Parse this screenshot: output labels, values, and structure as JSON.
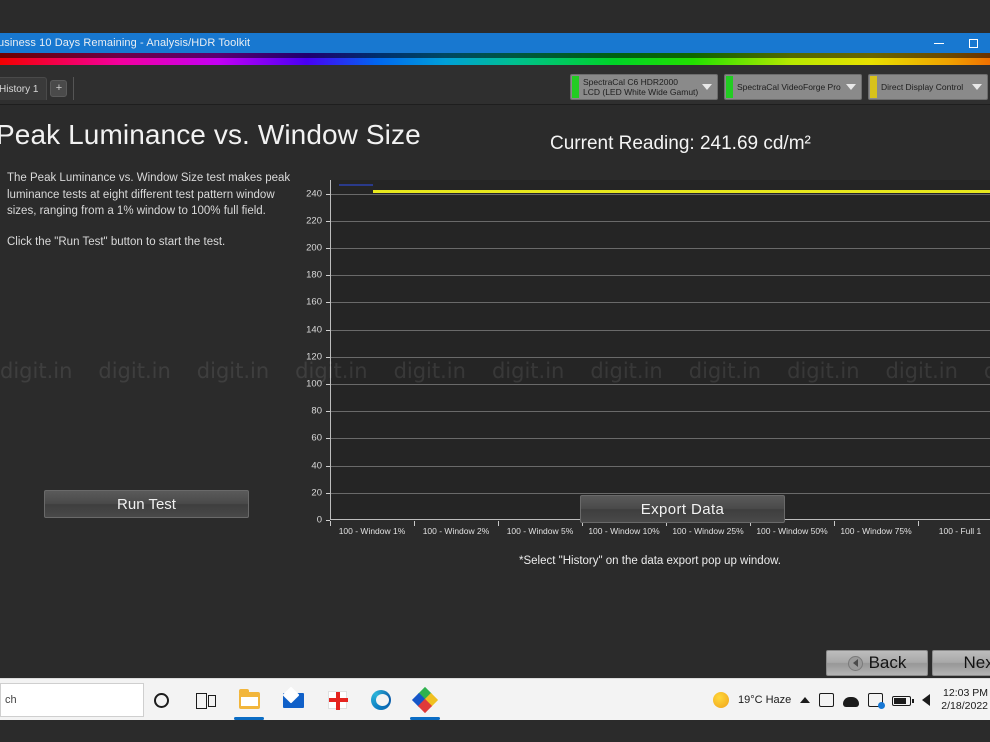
{
  "window": {
    "title": "usiness 10 Days Remaining  - Analysis/HDR Toolkit",
    "minimize_label": "Minimize",
    "maximize_label": "Maximize",
    "accent_color": "#1878d0"
  },
  "toolbar": {
    "tab_label": "History 1",
    "add_tab_label": "+",
    "devices": [
      {
        "line1": "SpectraCal C6 HDR2000",
        "line2": "LCD (LED White Wide Gamut)",
        "status_color": "#22cc22"
      },
      {
        "line1": "SpectraCal VideoForge Pro",
        "line2": "",
        "status_color": "#22cc22"
      },
      {
        "line1": "Direct Display Control",
        "line2": "",
        "status_color": "#d8c21a"
      }
    ]
  },
  "main": {
    "page_title": "Peak Luminance vs. Window Size",
    "description_p1": "The Peak Luminance vs. Window Size test makes peak luminance tests at eight different test pattern window sizes, ranging from a 1% window to 100% full field.",
    "description_p2": "Click the \"Run Test\" button to start the test.",
    "run_test_label": "Run Test",
    "current_reading": "Current Reading: 241.69 cd/m²",
    "export_label": "Export  Data",
    "export_note": "*Select \"History\" on the data export pop up window.",
    "back_label": "Back",
    "next_label": "Next"
  },
  "chart_data": {
    "type": "line",
    "title": "",
    "xlabel": "",
    "ylabel": "",
    "ylim": [
      0,
      250
    ],
    "yticks": [
      0,
      20,
      40,
      60,
      80,
      100,
      120,
      140,
      160,
      180,
      200,
      220,
      240
    ],
    "grid": true,
    "legend": "none",
    "categories": [
      "100 - Window 1%",
      "100 - Window 2%",
      "100 - Window 5%",
      "100 - Window 10%",
      "100 - Window 25%",
      "100 - Window 50%",
      "100 - Window 75%",
      "100 - Full 1"
    ],
    "series": [
      {
        "name": "Peak Luminance",
        "color": "#e8e81e",
        "values": [
          241.69,
          241.69,
          241.69,
          241.69,
          241.69,
          241.69,
          241.69,
          241.69
        ]
      }
    ],
    "line_color": "#e8e81e",
    "plot_background": "#252525"
  },
  "watermark": {
    "text": "digit.in",
    "repeat": 17
  },
  "taskbar": {
    "search_value": "ch",
    "weather_text": "19°C  Haze",
    "time": "12:03 PM",
    "date": "2/18/2022"
  }
}
